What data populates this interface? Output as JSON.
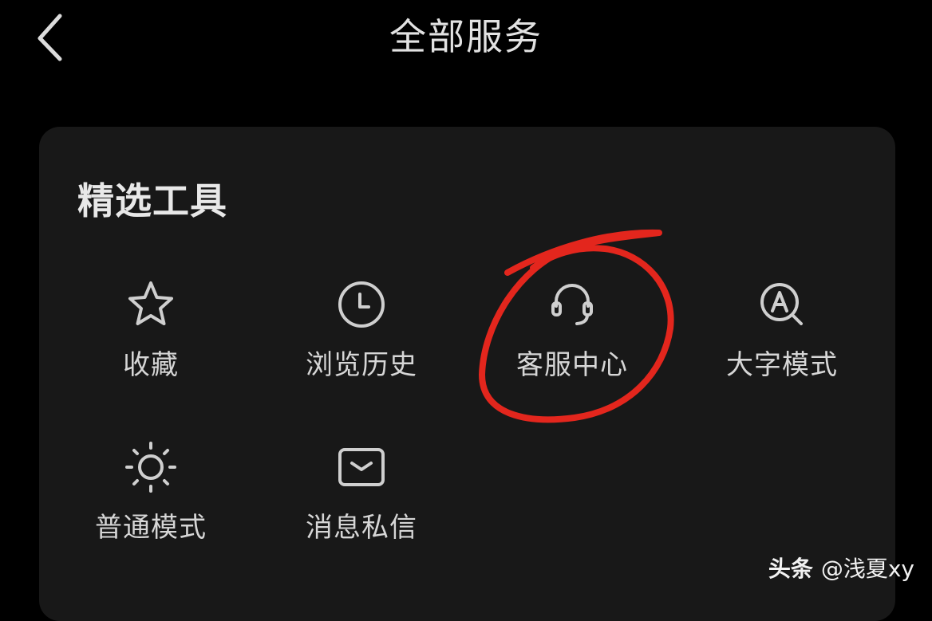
{
  "header": {
    "title": "全部服务",
    "back_icon": "chevron-left-icon"
  },
  "section": {
    "title": "精选工具"
  },
  "tools": [
    {
      "label": "收藏",
      "icon": "star-icon"
    },
    {
      "label": "浏览历史",
      "icon": "clock-icon"
    },
    {
      "label": "客服中心",
      "icon": "headset-icon",
      "annotated": true
    },
    {
      "label": "大字模式",
      "icon": "font-search-icon"
    },
    {
      "label": "普通模式",
      "icon": "sun-icon"
    },
    {
      "label": "消息私信",
      "icon": "message-icon"
    }
  ],
  "annotation": {
    "shape": "hand-drawn circle",
    "color": "#e3261d"
  },
  "watermark": {
    "logo": "头条",
    "handle": "@浅夏xy"
  },
  "colors": {
    "background": "#000000",
    "card": "#181818",
    "text": "#d6d6d6",
    "icon": "#cfcfcf"
  }
}
